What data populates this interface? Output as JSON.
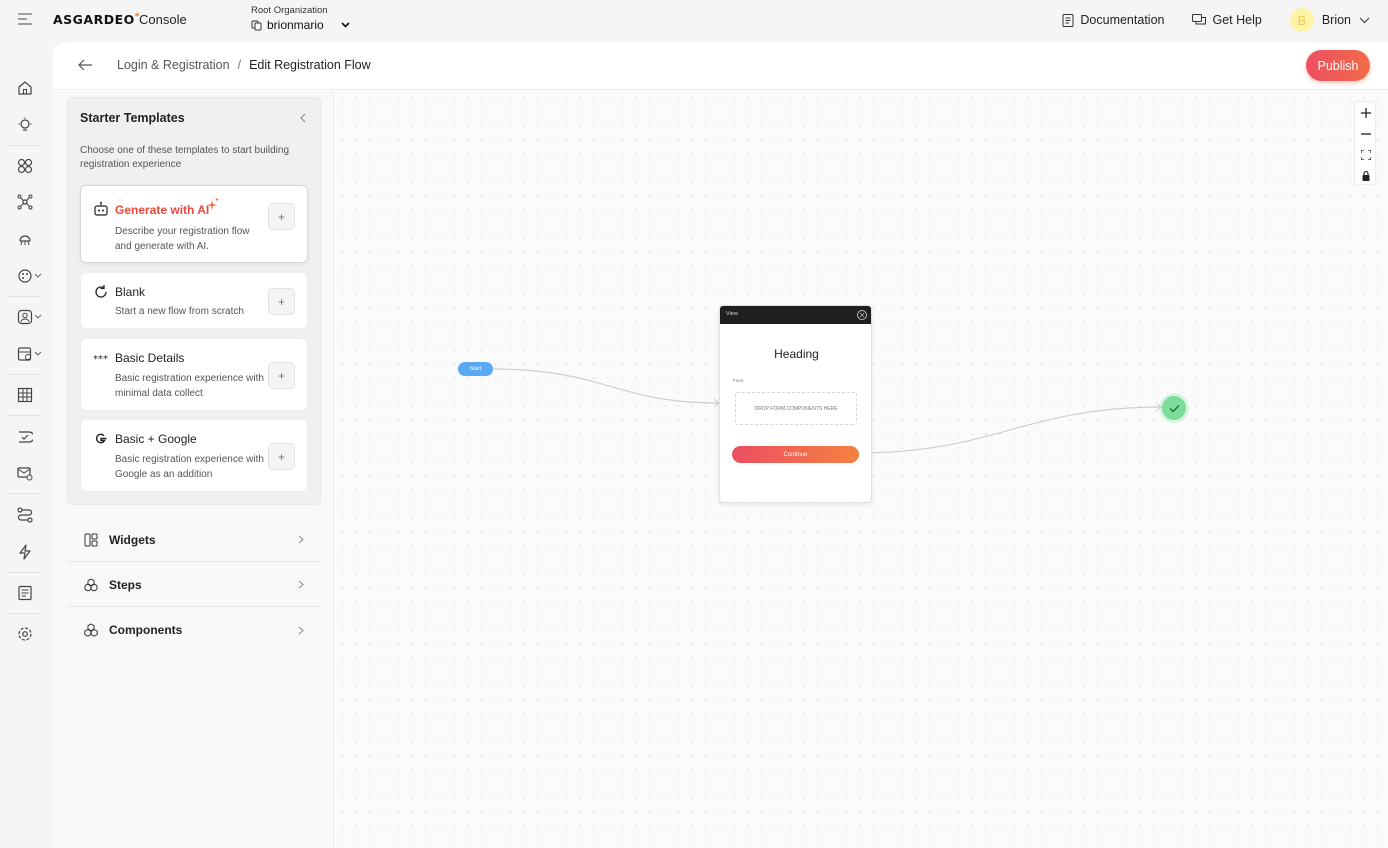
{
  "topbar": {
    "logo_text": "ASGARDEO",
    "logo_mark": "*",
    "product": "Console",
    "org_label": "Root Organization",
    "org_name": "brionmario",
    "documentation": "Documentation",
    "get_help": "Get Help",
    "user_initial": "B",
    "user_name": "Brion"
  },
  "nav": {
    "icons": [
      "home-icon",
      "lightbulb-icon",
      "applications-icon",
      "connections-icon",
      "api-resources-icon",
      "branding-icon",
      "user-management-icon",
      "organizations-icon",
      "insights-icon",
      "verified-domains-icon",
      "email-settings-icon",
      "flows-icon",
      "actions-icon",
      "logs-icon",
      "settings-icon"
    ]
  },
  "header": {
    "breadcrumb_parent": "Login & Registration",
    "breadcrumb_separator": "/",
    "breadcrumb_current": "Edit Registration Flow",
    "publish_label": "Publish"
  },
  "panel": {
    "starter_title": "Starter Templates",
    "starter_desc": "Choose one of these templates to start building registration experience",
    "templates": [
      {
        "name": "Generate with AI",
        "desc": "Describe your registration flow and generate with AI.",
        "icon": "ai-robot-icon"
      },
      {
        "name": "Blank",
        "desc": "Start a new flow from scratch",
        "icon": "refresh-icon"
      },
      {
        "name": "Basic Details",
        "desc": "Basic registration experience with minimal data collect",
        "icon": "password-dots-icon"
      },
      {
        "name": "Basic + Google",
        "desc": "Basic registration experience with Google as an addition",
        "icon": "google-icon"
      }
    ],
    "add_label": "+",
    "sections": [
      {
        "label": "Widgets",
        "icon": "widgets-icon"
      },
      {
        "label": "Steps",
        "icon": "steps-icon"
      },
      {
        "label": "Components",
        "icon": "components-icon"
      }
    ]
  },
  "canvas": {
    "start_label": "Start",
    "view": {
      "title": "View",
      "heading": "Heading",
      "form_label": "Form",
      "dropzone": "DROP FORM COMPONENTS HERE",
      "button": "Continue"
    },
    "zoom": [
      "zoom-in-icon",
      "zoom-out-icon",
      "fit-view-icon",
      "lock-icon"
    ]
  },
  "colors": {
    "accent": "#ef5b55",
    "start_node": "#5aa9f5",
    "end_node": "#7cdc9a"
  }
}
